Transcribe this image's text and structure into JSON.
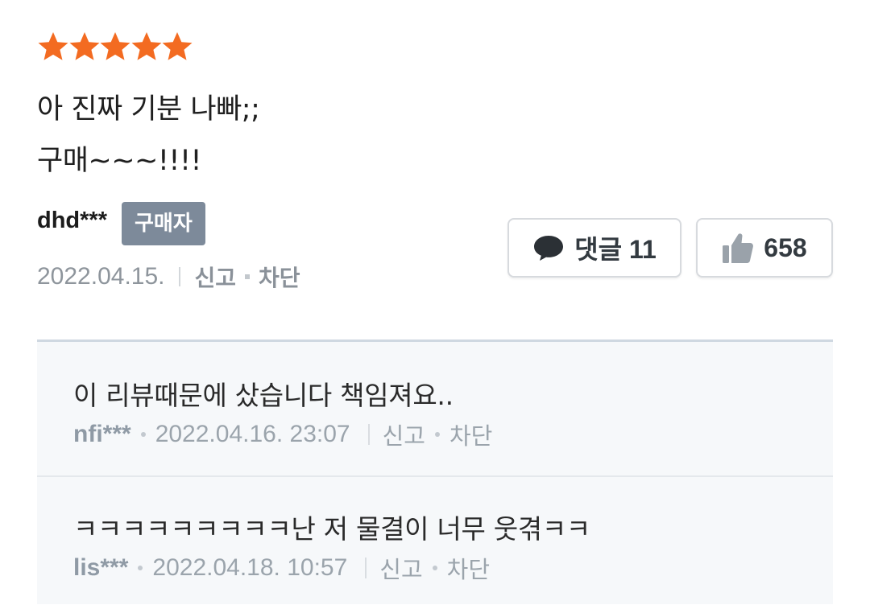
{
  "review": {
    "rating": 5,
    "rating_max": 5,
    "star_color": "#f36b21",
    "lines": [
      "아 진짜 기분 나빠;;",
      "구매~~~!!!!"
    ],
    "author": "dhd***",
    "badge": "구매자",
    "badge_color": "#7d8a9a",
    "date": "2022.04.15.",
    "report_label": "신고",
    "block_label": "차단",
    "comment_button": {
      "icon": "speech-bubble-icon",
      "label": "댓글 11"
    },
    "like_button": {
      "icon": "thumbs-up-icon",
      "count": "658"
    }
  },
  "comments": [
    {
      "text": "이 리뷰때문에 샀습니다 책임져요..",
      "author": "nfi***",
      "datetime": "2022.04.16. 23:07",
      "report_label": "신고",
      "block_label": "차단"
    },
    {
      "text": "ㅋㅋㅋㅋㅋㅋㅋㅋㅋ난 저 물결이 너무 웃겪ㅋㅋ",
      "author": "lis***",
      "datetime": "2022.04.18. 10:57",
      "report_label": "신고",
      "block_label": "차단"
    }
  ]
}
